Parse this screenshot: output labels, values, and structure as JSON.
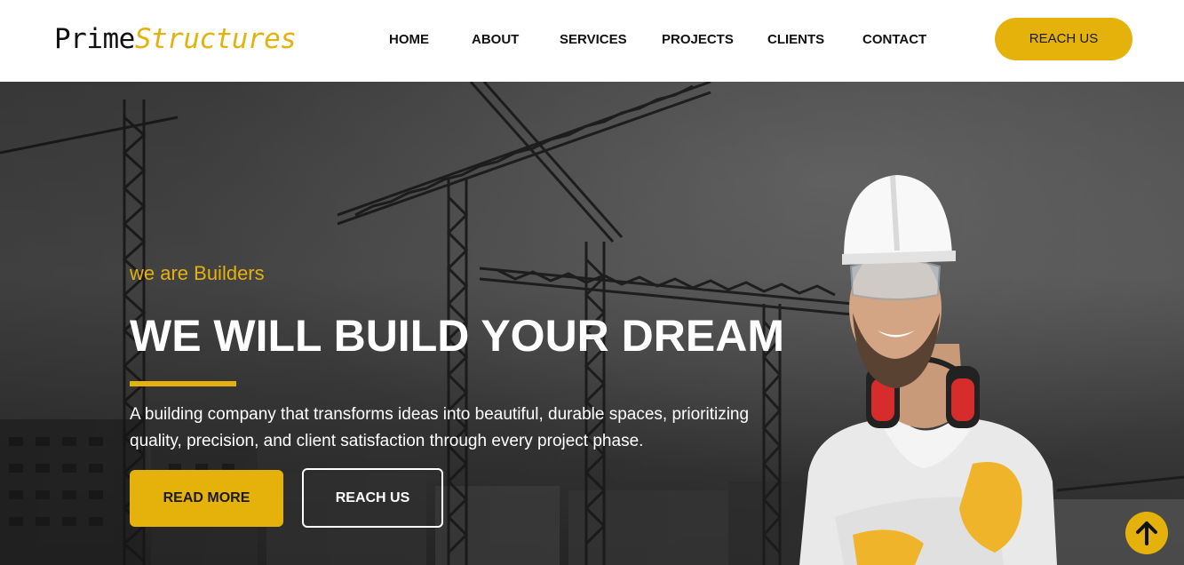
{
  "brand": {
    "name_part1": "Prime",
    "name_part2": "Structures",
    "accent_color": "#e5b20b"
  },
  "nav": {
    "items": [
      {
        "label": "HOME"
      },
      {
        "label": "ABOUT"
      },
      {
        "label": "SERVICES"
      },
      {
        "label": "PROJECTS"
      },
      {
        "label": "CLIENTS"
      },
      {
        "label": "CONTACT"
      }
    ],
    "cta_label": "REACH US"
  },
  "hero": {
    "kicker": "we are Builders",
    "title": "WE WILL BUILD YOUR DREAM",
    "text": "A building company that transforms ideas into beautiful, durable spaces, prioritizing quality, precision, and client satisfaction through every project phase.",
    "primary_button": "READ MORE",
    "secondary_button": "REACH US",
    "background": "construction-cranes-photo",
    "image": "worker-with-hard-hat-photo"
  },
  "scroll_top": {
    "icon": "arrow-up-icon"
  }
}
